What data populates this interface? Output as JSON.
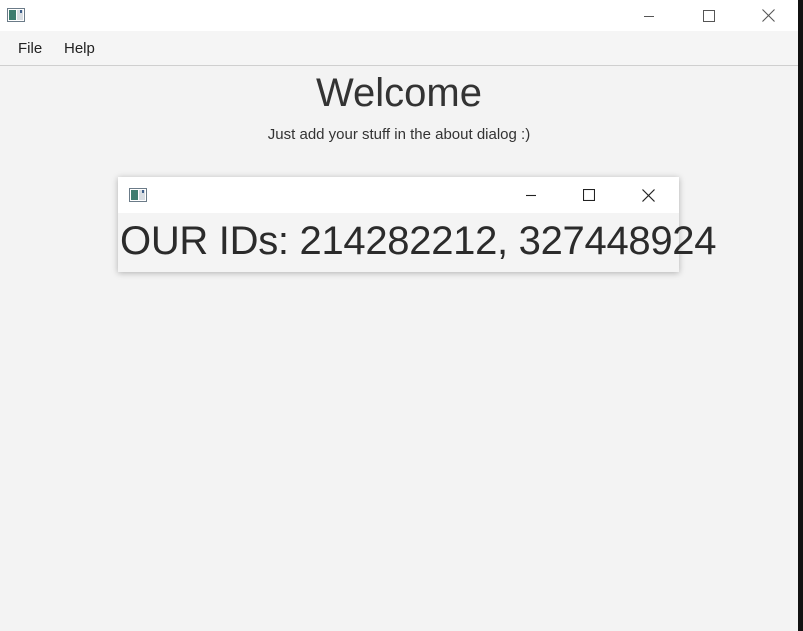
{
  "window": {
    "icon": "app-window-icon",
    "controls": {
      "minimize": "minimize-icon",
      "maximize": "maximize-icon",
      "close": "close-icon"
    }
  },
  "menubar": {
    "items": [
      {
        "label": "File"
      },
      {
        "label": "Help"
      }
    ]
  },
  "main": {
    "heading": "Welcome",
    "subheading": "Just add your stuff in the about dialog :)"
  },
  "dialog": {
    "icon": "app-window-icon",
    "controls": {
      "minimize": "minimize-icon",
      "maximize": "maximize-icon",
      "close": "close-icon"
    },
    "text": "OUR IDs: 214282212, 327448924"
  },
  "colors": {
    "background": "#f3f3f3",
    "titlebar": "#ffffff",
    "text": "#333333"
  }
}
